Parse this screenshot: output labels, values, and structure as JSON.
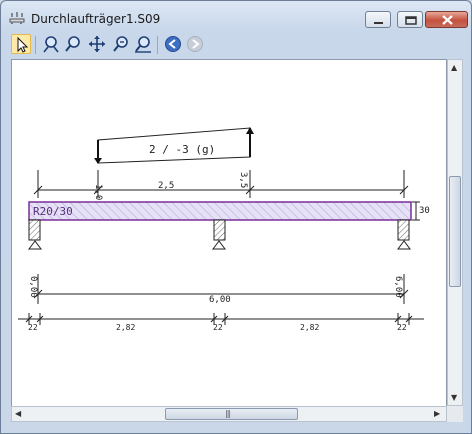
{
  "window": {
    "title": "Durchlaufträger1.S09"
  },
  "toolbar": {
    "tools": [
      {
        "name": "select-tool",
        "icon": "cursor-arrow-icon"
      },
      {
        "name": "zoom-in-tool",
        "icon": "zoom-in-icon"
      },
      {
        "name": "zoom-tool",
        "icon": "magnifier-icon"
      },
      {
        "name": "pan-tool",
        "icon": "move-cross-icon"
      },
      {
        "name": "zoom-window-tool",
        "icon": "zoom-window-icon"
      },
      {
        "name": "zoom-all-tool",
        "icon": "zoom-all-icon"
      },
      {
        "name": "back-tool",
        "icon": "back-arrow-icon"
      },
      {
        "name": "forward-tool",
        "icon": "forward-arrow-icon"
      }
    ]
  },
  "drawing": {
    "load_label": "2 / -3 (g)",
    "load_start": "1,0",
    "load_end": "3,5",
    "load_span": "2,5",
    "section_label": "R20/30",
    "height_label": "30",
    "support_left": "0,00",
    "support_right": "6,00",
    "total_length": "6,00",
    "dims_bottom": [
      "22",
      "2,82",
      "22",
      "2,82",
      "22"
    ]
  },
  "colors": {
    "beam_fill": "#e6e1f4",
    "beam_hatch": "#b5aee6",
    "beam_border": "#7a2d9a",
    "support_fill": "#cfd4dc"
  }
}
